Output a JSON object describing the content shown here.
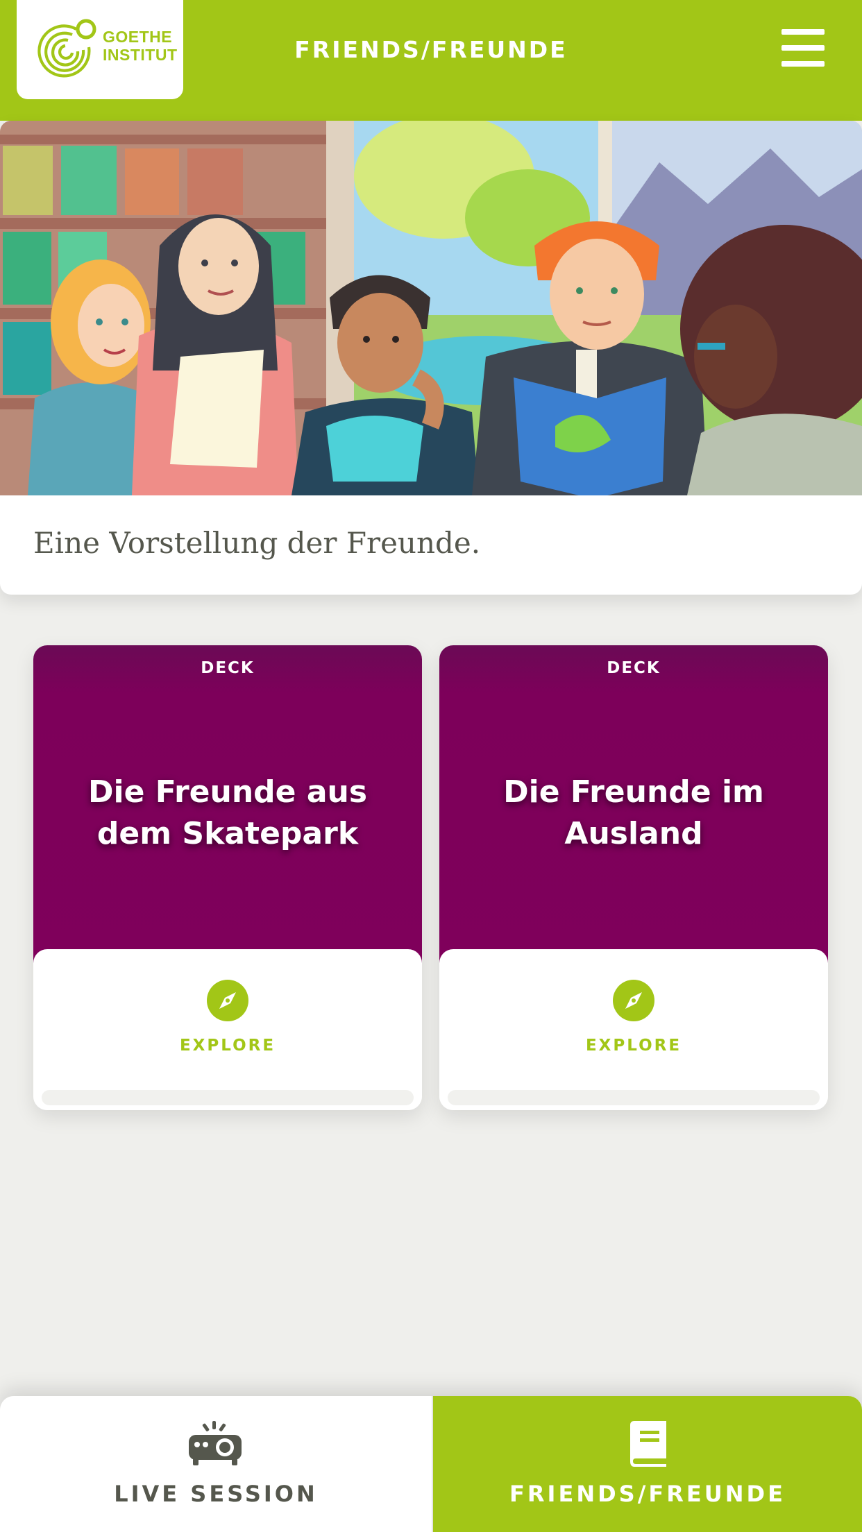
{
  "header": {
    "logo_text_line1": "GOETHE",
    "logo_text_line2": "INSTITUT",
    "title": "FRIENDS/FREUNDE",
    "menu_icon": "hamburger-menu-icon"
  },
  "hero": {
    "caption": "Eine Vorstellung der Freunde."
  },
  "decks": [
    {
      "label": "DECK",
      "title": "Die Freunde aus dem Skatepark",
      "action_icon": "compass-icon",
      "action_label": "EXPLORE",
      "progress": 0
    },
    {
      "label": "DECK",
      "title": "Die Freunde im Ausland",
      "action_icon": "compass-icon",
      "action_label": "EXPLORE",
      "progress": 0
    }
  ],
  "bottom_nav": {
    "tabs": [
      {
        "label": "LIVE SESSION",
        "icon": "projector-icon",
        "active": false
      },
      {
        "label": "FRIENDS/FREUNDE",
        "icon": "book-icon",
        "active": true
      }
    ]
  },
  "colors": {
    "brand_green": "#a2c617",
    "deck_purple": "#7f005b",
    "background": "#efefec",
    "text_dark": "#55574d"
  }
}
